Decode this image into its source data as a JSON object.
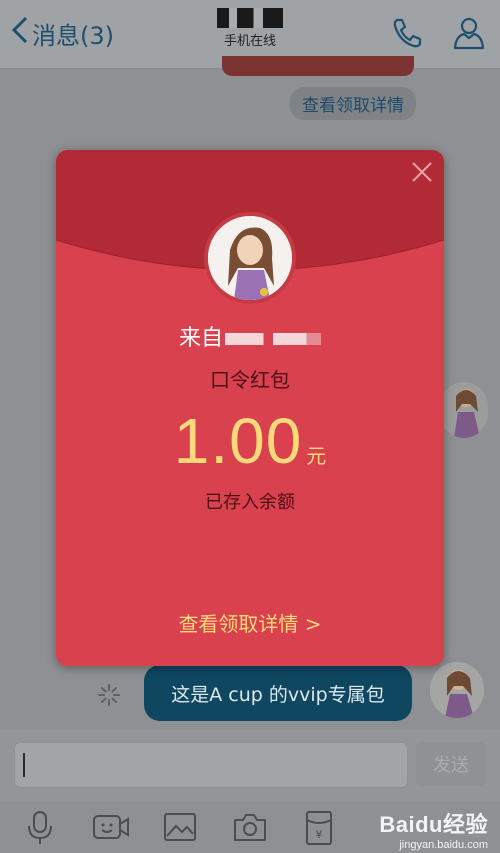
{
  "header": {
    "back_label": "消息(3)",
    "subtitle": "手机在线"
  },
  "chat": {
    "previous_pill": "查看领取详情",
    "own_message": "这是A cup 的vvip专属包"
  },
  "input": {
    "send_label": "发送"
  },
  "red_packet": {
    "from_label": "来自",
    "type": "口令红包",
    "amount": "1.00",
    "unit": "元",
    "status": "已存入余额",
    "details_link": "查看领取详情 >"
  },
  "watermark": {
    "brand": "Baidu经验",
    "url": "jingyan.baidu.com"
  },
  "colors": {
    "envelope_red": "#d8414d",
    "flap_red": "#b32a37",
    "gold": "#fad97a",
    "header_blue": "#1f4f6e"
  },
  "icons": [
    "back-chevron-icon",
    "phone-icon",
    "profile-icon",
    "close-icon",
    "microphone-icon",
    "video-icon",
    "image-icon",
    "camera-icon",
    "red-packet-icon",
    "loading-spinner-icon"
  ]
}
